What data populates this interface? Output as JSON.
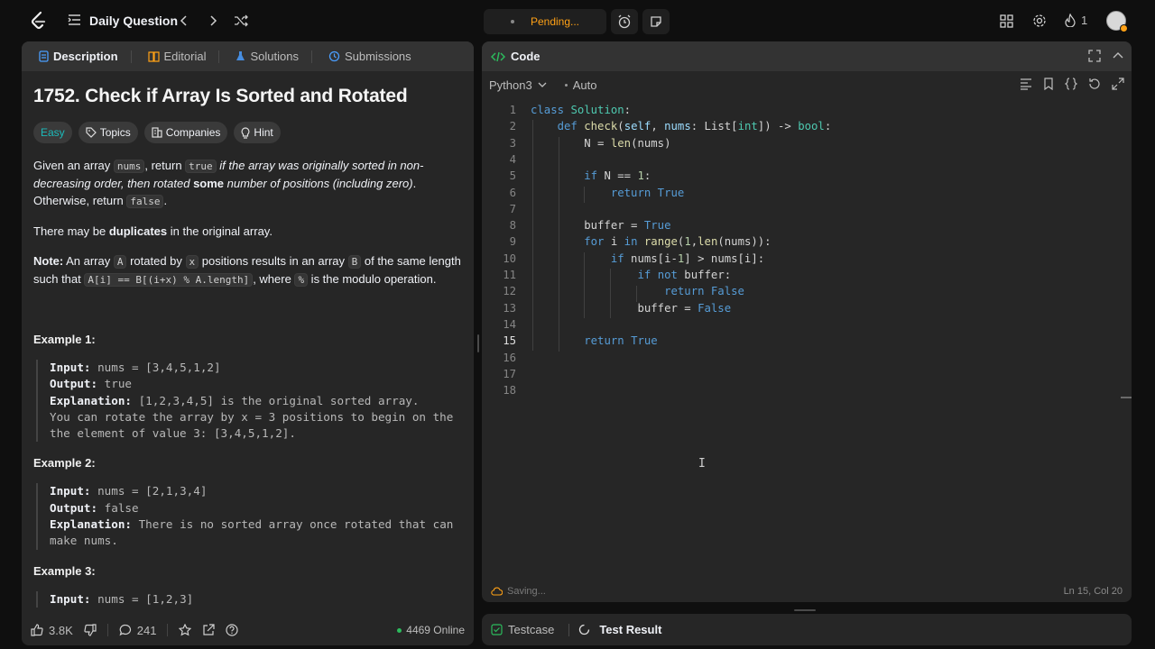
{
  "topbar": {
    "title": "Daily Question",
    "pending": "Pending...",
    "streak_count": "1"
  },
  "left_tabs": [
    "Description",
    "Editorial",
    "Solutions",
    "Submissions"
  ],
  "problem": {
    "title": "1752. Check if Array Is Sorted and Rotated",
    "chips": [
      "Easy",
      "Topics",
      "Companies",
      "Hint"
    ],
    "p1": {
      "a": "Given an array ",
      "code1": "nums",
      "b": ", return ",
      "code2": "true",
      "c": " if the array was originally sorted in non-decreasing order, then rotated ",
      "d": "some",
      "e": " number of positions (including zero)",
      "f": ". Otherwise, return ",
      "code3": "false",
      "g": "."
    },
    "p2": {
      "a": "There may be ",
      "b": "duplicates",
      "c": " in the original array."
    },
    "p3": {
      "label": "Note:",
      "a": " An array ",
      "code1": "A",
      "b": " rotated by ",
      "code2": "x",
      "c": " positions results in an array ",
      "code3": "B",
      "d": " of the same length such that ",
      "code4": "A[i] == B[(i+x) % A.length]",
      "e": ", where ",
      "code5": "%",
      "f": " is the modulo operation."
    },
    "examples": [
      {
        "title": "Example 1:",
        "input_label": "Input:",
        "input": " nums = [3,4,5,1,2]",
        "output_label": "Output:",
        "output": " true",
        "expl_label": "Explanation:",
        "explanation": " [1,2,3,4,5] is the original sorted array.",
        "expl_cont1": "You can rotate the array by x = 3 positions to begin on the",
        "expl_cont2": "the element of value 3: [3,4,5,1,2]."
      },
      {
        "title": "Example 2:",
        "input_label": "Input:",
        "input": " nums = [2,1,3,4]",
        "output_label": "Output:",
        "output": " false",
        "expl_label": "Explanation:",
        "explanation": " There is no sorted array once rotated that can",
        "expl_cont1": "make nums."
      },
      {
        "title": "Example 3:",
        "input_label": "Input:",
        "input": " nums = [1,2,3]"
      }
    ]
  },
  "left_footer": {
    "likes": "3.8K",
    "comments": "241",
    "online": "4469 Online"
  },
  "code_panel": {
    "title": "Code",
    "language": "Python3",
    "mode": "Auto",
    "status_left": "Saving...",
    "status_right": "Ln 15, Col 20",
    "line_numbers": [
      "1",
      "2",
      "3",
      "4",
      "5",
      "6",
      "7",
      "8",
      "9",
      "10",
      "11",
      "12",
      "13",
      "14",
      "15",
      "16",
      "17",
      "18"
    ]
  },
  "bottom_tabs": [
    "Testcase",
    "Test Result"
  ],
  "colors": {
    "accent_orange": "#ffa116",
    "easy": "#1cbaba",
    "keyword": "#569cd6",
    "type": "#4ec9b0",
    "function": "#dcdcaa",
    "online_dot": "#2cbb5d"
  },
  "icons": [
    "leetcode-logo",
    "list-icon",
    "chevron-left-icon",
    "chevron-right-icon",
    "shuffle-icon",
    "alarm-icon",
    "note-icon",
    "grid-icon",
    "gear-icon",
    "fire-icon",
    "avatar"
  ]
}
